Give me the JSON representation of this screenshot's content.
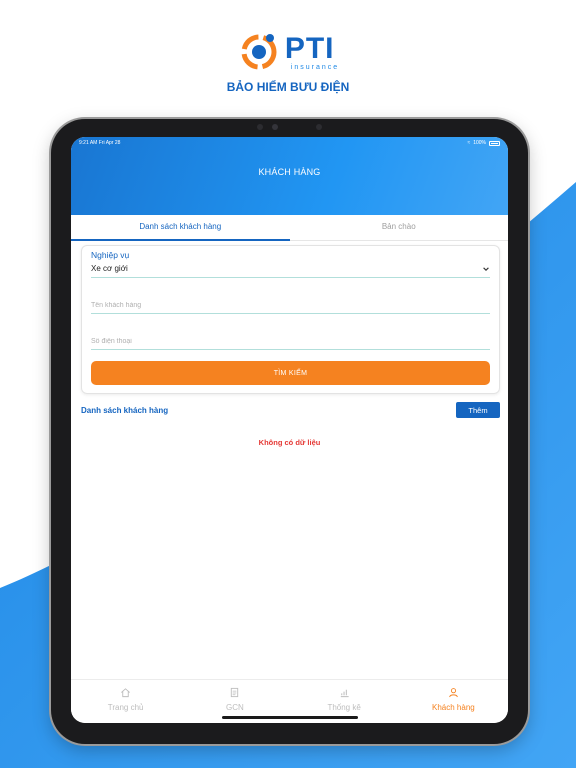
{
  "brand": {
    "name": "PTI",
    "tagline": "insurance",
    "subtitle": "BẢO HIỂM BƯU ĐIỆN",
    "colors": {
      "primary": "#1565c0",
      "accent": "#f58220"
    }
  },
  "statusbar": {
    "time": "9:21 AM",
    "date": "Fri Apr 28",
    "battery": "100%"
  },
  "header": {
    "title": "KHÁCH HÀNG"
  },
  "tabs": [
    {
      "label": "Danh sách khách hàng",
      "active": true
    },
    {
      "label": "Bản chào",
      "active": false
    }
  ],
  "form": {
    "business_label": "Nghiệp vụ",
    "business_value": "Xe cơ giới",
    "customer_name_placeholder": "Tên khách hàng",
    "phone_placeholder": "Số điện thoại",
    "search_button": "TÌM KIẾM"
  },
  "list": {
    "title": "Danh sách khách hàng",
    "add_button": "Thêm",
    "empty_message": "Không có dữ liệu"
  },
  "bottom_nav": [
    {
      "label": "Trang chủ",
      "icon": "home-icon",
      "active": false
    },
    {
      "label": "GCN",
      "icon": "document-icon",
      "active": false
    },
    {
      "label": "Thống kê",
      "icon": "chart-icon",
      "active": false
    },
    {
      "label": "Khách hàng",
      "icon": "user-icon",
      "active": true
    }
  ]
}
